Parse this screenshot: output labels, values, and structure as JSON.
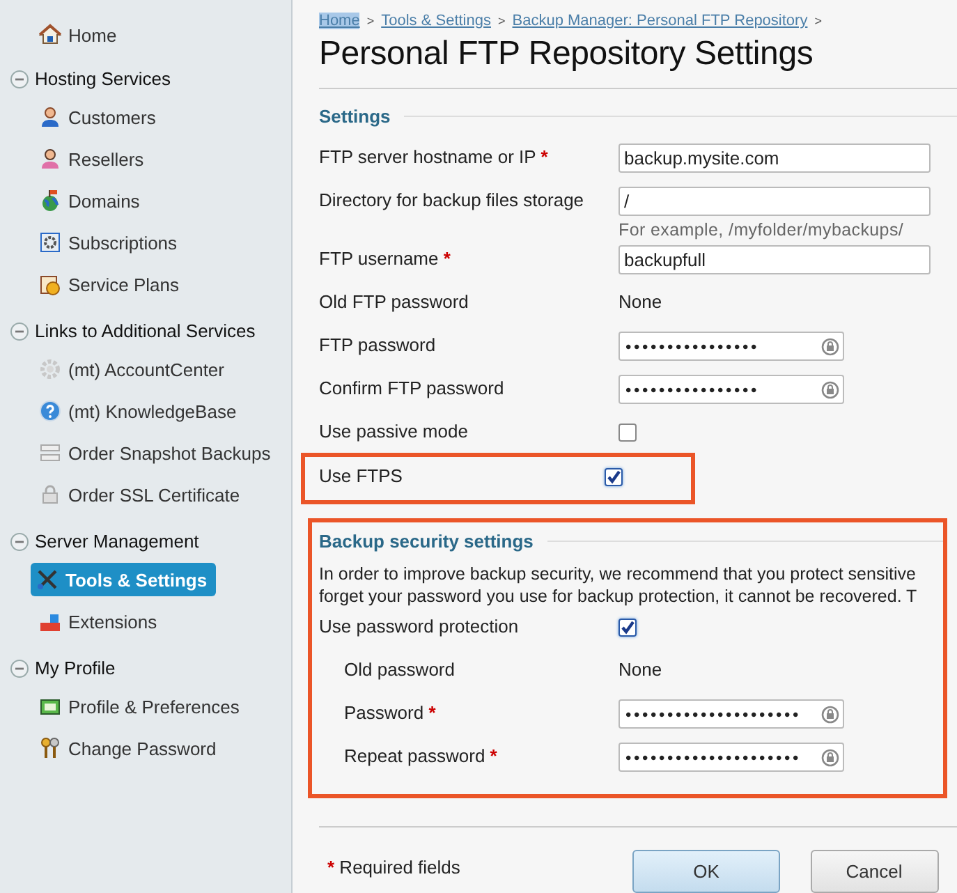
{
  "sidebar": {
    "home": {
      "label": "Home",
      "selected": false
    },
    "sections": [
      {
        "title": "Hosting Services",
        "expanded": true,
        "items": [
          {
            "label": "Customers",
            "selected": false
          },
          {
            "label": "Resellers",
            "selected": false
          },
          {
            "label": "Domains",
            "selected": false
          },
          {
            "label": "Subscriptions",
            "selected": false
          },
          {
            "label": "Service Plans",
            "selected": false
          }
        ]
      },
      {
        "title": "Links to Additional Services",
        "expanded": true,
        "items": [
          {
            "label": "(mt) AccountCenter",
            "selected": false
          },
          {
            "label": "(mt) KnowledgeBase",
            "selected": false
          },
          {
            "label": "Order Snapshot Backups",
            "selected": false
          },
          {
            "label": "Order SSL Certificate",
            "selected": false
          }
        ]
      },
      {
        "title": "Server Management",
        "expanded": true,
        "items": [
          {
            "label": "Tools & Settings",
            "selected": true
          },
          {
            "label": "Extensions",
            "selected": false
          }
        ]
      },
      {
        "title": "My Profile",
        "expanded": true,
        "items": [
          {
            "label": "Profile & Preferences",
            "selected": false
          },
          {
            "label": "Change Password",
            "selected": false
          }
        ]
      }
    ]
  },
  "breadcrumbs": [
    {
      "label": "Home",
      "highlighted": true,
      "separator": ">"
    },
    {
      "label": "Tools & Settings",
      "highlighted": false,
      "separator": ">"
    },
    {
      "label": "Backup Manager: Personal FTP Repository",
      "highlighted": false,
      "separator": ">"
    }
  ],
  "title": "Personal FTP Repository Settings",
  "settings": {
    "legend": "Settings",
    "rows": [
      {
        "kind": "text",
        "label": "FTP server hostname or IP",
        "required_mark": "*",
        "value": "backup.mysite.com"
      },
      {
        "kind": "text",
        "label": "Directory for backup files storage",
        "value": "/",
        "hint": "For example, /myfolder/mybackups/"
      },
      {
        "kind": "text",
        "label": "FTP username",
        "required_mark": "*",
        "value": "backupfull"
      },
      {
        "kind": "static",
        "label": "Old FTP password",
        "value": "None"
      },
      {
        "kind": "password",
        "label": "FTP password",
        "value": "••••••••••••••••"
      },
      {
        "kind": "password",
        "label": "Confirm FTP password",
        "value": "••••••••••••••••"
      },
      {
        "kind": "checkbox",
        "label": "Use passive mode",
        "checked": false,
        "highlighted": false
      },
      {
        "kind": "checkbox",
        "label": "Use FTPS",
        "checked": true,
        "highlighted": true
      }
    ]
  },
  "security": {
    "legend": "Backup security settings",
    "highlighted": true,
    "description": [
      "In order to improve backup security, we recommend that you protect sensitive",
      "forget your password you use for backup protection, it cannot be recovered. T"
    ],
    "rows": [
      {
        "kind": "checkbox",
        "label": "Use password protection",
        "checked": true,
        "highlighted": false,
        "children": [
          {
            "kind": "static",
            "label": "Old password",
            "value": "None"
          },
          {
            "kind": "password",
            "label": "Password",
            "required_mark": "*",
            "value": "•••••••••••••••••••••"
          },
          {
            "kind": "password",
            "label": "Repeat password",
            "required_mark": "*",
            "value": "•••••••••••••••••••••"
          }
        ]
      }
    ]
  },
  "footer": {
    "required_mark": "*",
    "note": "Required fields"
  },
  "buttons": [
    {
      "label": "OK",
      "kind": "primary"
    },
    {
      "label": "Cancel",
      "kind": "secondary"
    }
  ]
}
